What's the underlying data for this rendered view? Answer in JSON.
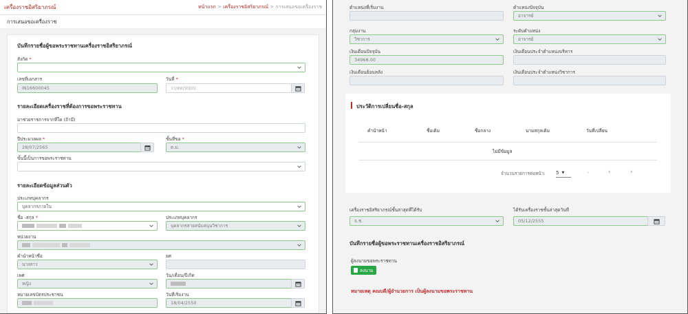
{
  "left": {
    "brand": "เครื่องราชอิสริยาภรณ์",
    "breadcrumb": {
      "home": "หน้าแรก",
      "sep1": ">",
      "section": "เครื่องราชอิสริยาภรณ์",
      "sep2": ">",
      "current": "การเสนอขอเครื่องราช"
    },
    "page_title": "การเสนอขอเครื่องราช",
    "form_title": "บันทึกรายชื่อผู้ขอพระราชทานเครื่องราชอิสริยาภรณ์",
    "fields": {
      "affiliation_label": "สังกัด",
      "doc_no_label": "เลขที่เอกสาร",
      "doc_no_value": "IN16600045",
      "date_label": "วันที่",
      "date_placeholder": "วว/ดด/ปปปป"
    },
    "section_decoration": "รายละเอียดเครื่องราชที่ต้องการขอพระราชทาน",
    "deco": {
      "transfer_label": "มาช่วยราชการจากที่ใด (ถ้ามี)",
      "budget_year_label": "ปีประมวลผล",
      "budget_year_value": "28/07/2565",
      "class_label": "ชั้นที่ขอ",
      "class_value": "ต.ม.",
      "step_label": "ขั้นนี้เป็นการขอพระราชทาน"
    },
    "section_personal": "รายละเอียดข้อมูลส่วนตัว",
    "personal": {
      "type_label": "ประเภทบุคลากร",
      "type_value": "บุคลากรภายใน",
      "name_label": "ชื่อ -สกุล",
      "staff_type_label": "ประเภทบุคลากร",
      "staff_type_value": "บุคลากรสายสนับสนุนวิชาการ",
      "unit_label": "หน่วยงาน",
      "prefix_label": "คำนำหน้าชื่อ",
      "prefix_value": "นางสาว",
      "rank_label": "ยศ",
      "gender_label": "เพศ",
      "gender_value": "หญิง",
      "dob_label": "วัน/เดือน/ปีเกิด",
      "id_label": "หมายเลขบัตรประชาชน",
      "start_label": "วันที่เริ่มงาน",
      "start_value": "18/04/2550"
    }
  },
  "right": {
    "top": {
      "start_position_label": "ตำแหน่งที่เริ่มงาน",
      "current_position_label": "ตำแหน่งปัจจุบัน",
      "current_position_value": "อาจารย์",
      "group_label": "กลุ่มงาน",
      "group_value": "วิชาการ",
      "level_label": "ระดับตำแหน่ง",
      "level_value": "อาจารย์",
      "salary_label": "เงินเดือนปัจจุบัน",
      "salary_value": "34968.00",
      "admin_salary_label": "เงินเดือนประจำตำแหน่งบริหาร",
      "retro_salary_label": "เงินเดือนย้อนหลัง",
      "academic_salary_label": "เงินเดือนประจำตำแหน่งวิชาการ"
    },
    "history": {
      "title": "ประวัติการเปลี่ยนชื่อ-สกุล",
      "columns": [
        "คำนำหน้า",
        "ชื่อเดิม",
        "ชื่อกลาง",
        "นามสกุลเดิม",
        "วันที่เปลี่ยน"
      ],
      "empty": "ไม่มีข้อมูล",
      "rows_per_page_label": "จำนวนรายการต่อหน้า:",
      "rows_per_page_value": "5",
      "range": "-"
    },
    "last": {
      "last_deco_label": "เครื่องราชอิสริยาภรณ์ชั้นล่าสุดที่ได้รับ",
      "last_deco_value": "จ.ช.",
      "last_date_label": "ได้รับเครื่องราชชั้นล่าสุดวันที่",
      "last_date_value": "05/12/2555",
      "save_section_title": "บันทึกรายชื่อผู้ขอพระราชทานเครื่องราชอิสริยาภรณ์",
      "signer_label": "ผู้ลงนามขอพระราชทาน",
      "sign_button": "ลงนาม",
      "note": "หมายเหตุ คณบดี/ผู้อำนวยการ เป็นผู้ลงนามขอพระราชทาน"
    }
  }
}
